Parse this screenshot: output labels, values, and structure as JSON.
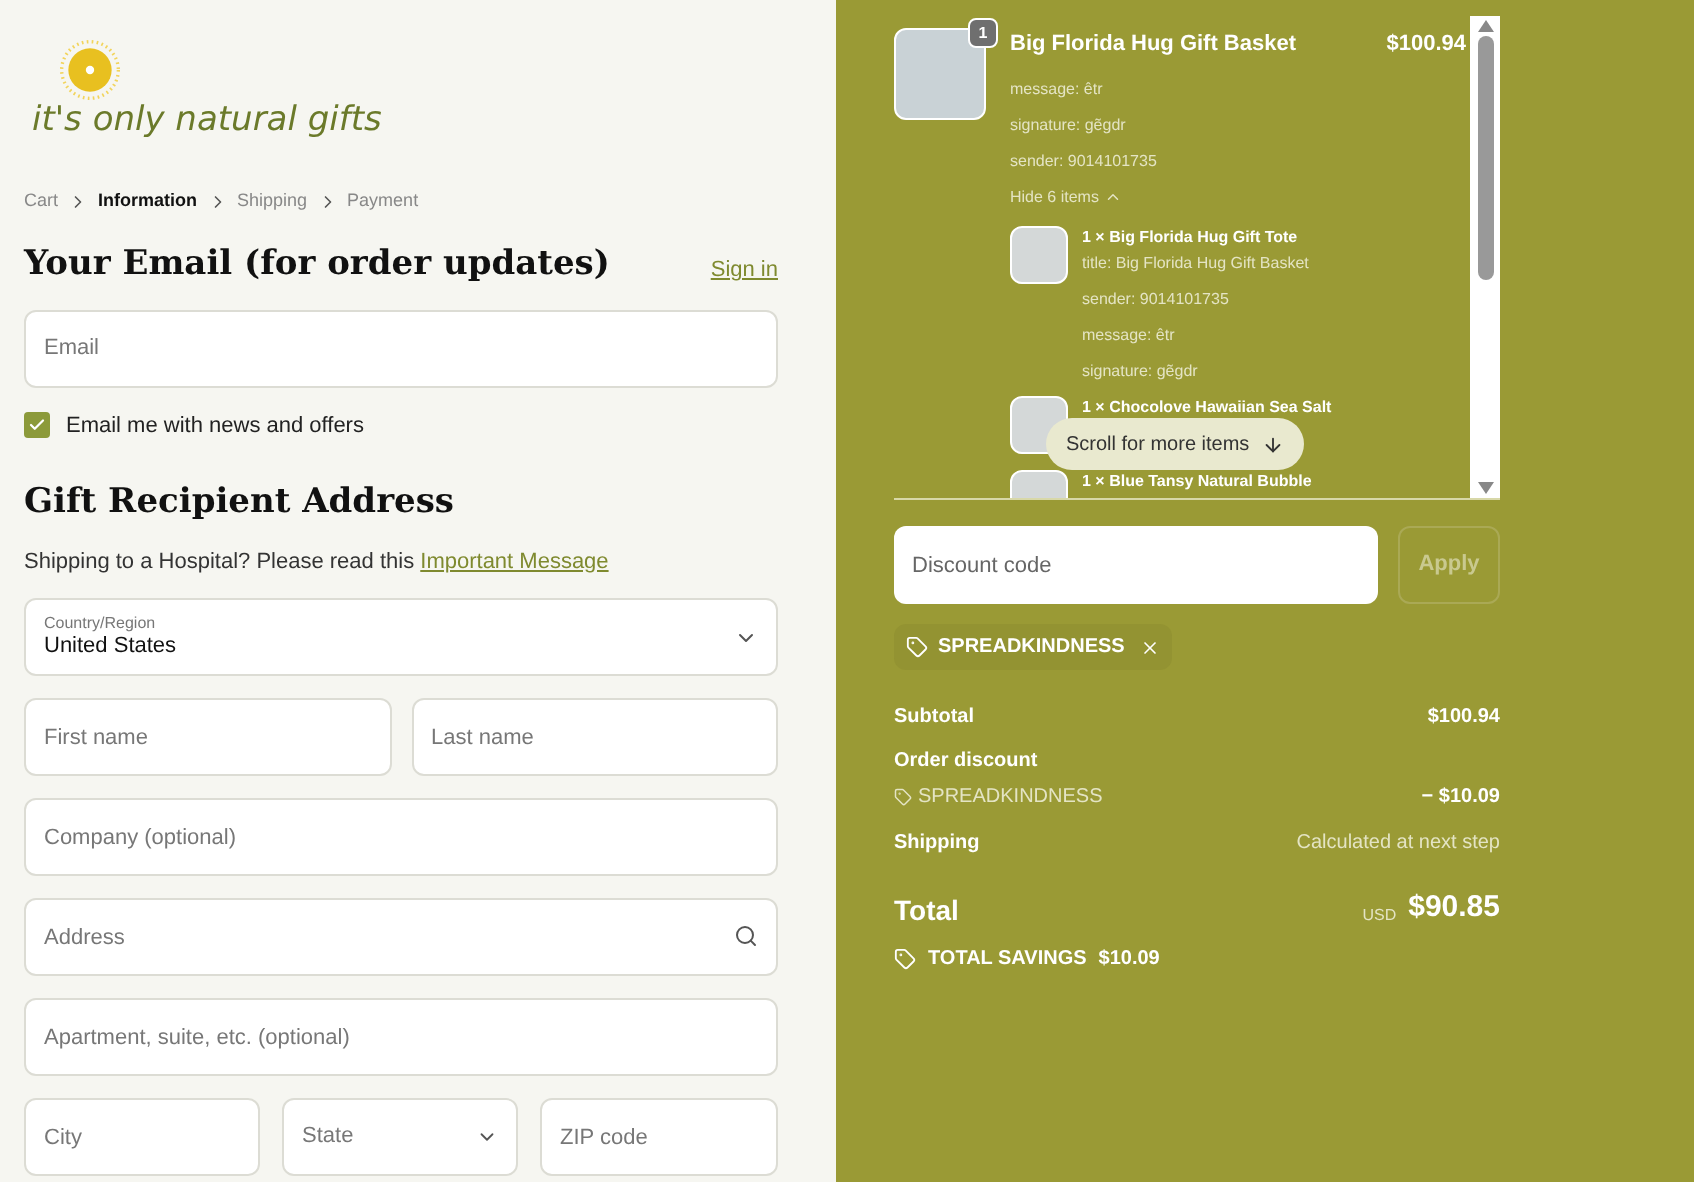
{
  "logo": {
    "text": "it's only natural gifts"
  },
  "breadcrumbs": [
    {
      "label": "Cart",
      "selected": false
    },
    {
      "label": "Information",
      "selected": true
    },
    {
      "label": "Shipping",
      "selected": false
    },
    {
      "label": "Payment",
      "selected": false
    }
  ],
  "contact": {
    "heading": "Your Email (for order updates)",
    "sign_in": "Sign in",
    "email": {
      "placeholder": "Email"
    },
    "newsletter": {
      "label": "Email me with news and offers",
      "checked": true
    }
  },
  "address": {
    "heading": "Gift Recipient Address",
    "note": "Shipping to a Hospital? Please read this",
    "note_link": "Important Message",
    "country": {
      "label": "Country/Region",
      "value": "United States"
    },
    "first_name": {
      "placeholder": "First name"
    },
    "last_name": {
      "placeholder": "Last name"
    },
    "company": {
      "placeholder": "Company (optional)"
    },
    "address": {
      "placeholder": "Address"
    },
    "apartment": {
      "placeholder": "Apartment, suite, etc. (optional)"
    },
    "city": {
      "placeholder": "City"
    },
    "state": {
      "placeholder": "State"
    },
    "zip": {
      "placeholder": "ZIP code"
    }
  },
  "cart": {
    "item": {
      "quantity": "1",
      "name": "Big Florida Hug Gift Basket",
      "price": "$100.94",
      "properties": [
        "message: êtr",
        "signature: gẽgdr",
        "sender: 9014101735"
      ],
      "toggle": "Hide 6 items",
      "expanded": true,
      "children": [
        {
          "name": "1 × Big Florida Hug Gift Tote",
          "properties": [
            "title: Big Florida Hug Gift Basket",
            "sender: 9014101735",
            "message: êtr",
            "signature: gẽgdr"
          ]
        },
        {
          "name": "1 × Chocolove Hawaiian Sea Salt"
        },
        {
          "name": "1 × Blue Tansy Natural Bubble"
        }
      ]
    },
    "scroll_hint": "Scroll for more items"
  },
  "discount": {
    "placeholder": "Discount code",
    "apply": "Apply",
    "apply_disabled": true,
    "applied_code": "SPREADKINDNESS"
  },
  "summary": {
    "subtotal_label": "Subtotal",
    "subtotal": "$100.94",
    "discount_label": "Order discount",
    "discount_code": "SPREADKINDNESS",
    "discount_amount": "− $10.09",
    "shipping_label": "Shipping",
    "shipping": "Calculated at next step",
    "total_label": "Total",
    "currency": "USD",
    "total": "$90.85",
    "savings_label": "TOTAL SAVINGS",
    "savings": "$10.09"
  }
}
